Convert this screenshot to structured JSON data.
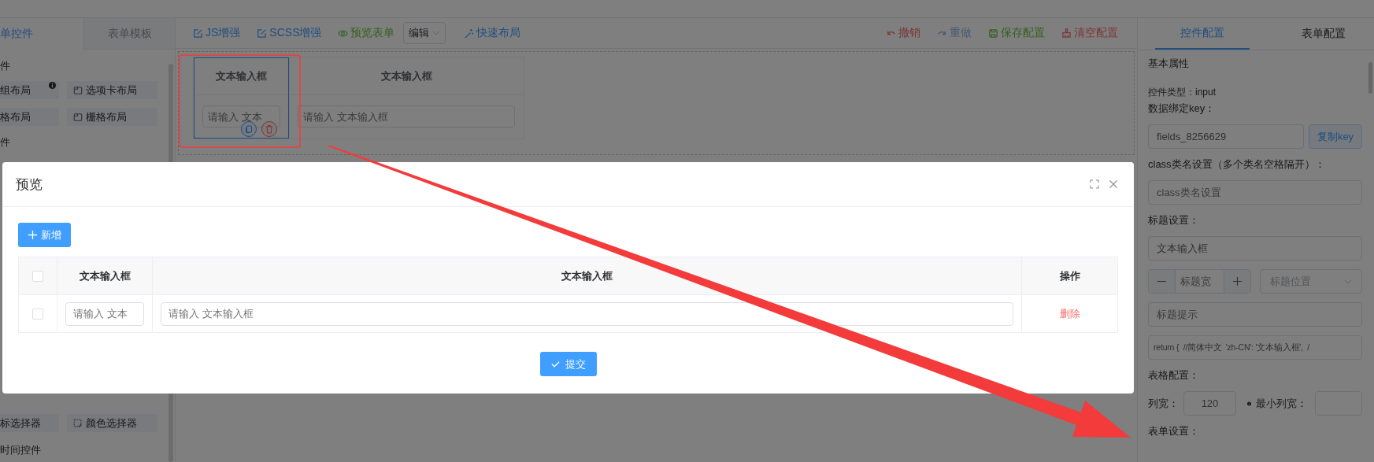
{
  "sidebar": {
    "tabs": [
      {
        "label": "单控件",
        "selected": true
      },
      {
        "label": "表单模板",
        "selected": false
      }
    ],
    "upper": [
      {
        "kind": "heading",
        "text": "件"
      },
      {
        "kind": "items",
        "items": [
          {
            "label": "组布局",
            "info": true
          },
          {
            "label": "选项卡布局",
            "info": false
          },
          {
            "label": "格布局",
            "info": false
          },
          {
            "label": "栅格布局",
            "info": false
          }
        ]
      },
      {
        "kind": "heading",
        "text": "件"
      }
    ],
    "lower": [
      {
        "kind": "items",
        "items": [
          {
            "label": "标选择器",
            "info": false
          },
          {
            "label": "颜色选择器",
            "info": false
          }
        ]
      },
      {
        "kind": "heading",
        "text": "时间控件"
      }
    ]
  },
  "toolbar": {
    "left": [
      {
        "kind": "link",
        "label": "JS增强"
      },
      {
        "kind": "link",
        "label": "SCSS增强"
      },
      {
        "kind": "link",
        "label": "预览表单"
      },
      {
        "kind": "select",
        "value": "编辑"
      },
      {
        "kind": "link",
        "label": "快速布局"
      }
    ],
    "right": [
      {
        "kind": "link",
        "label": "撤销"
      },
      {
        "kind": "link",
        "label": "重做"
      },
      {
        "kind": "link",
        "label": "保存配置"
      },
      {
        "kind": "link",
        "label": "清空配置"
      }
    ]
  },
  "canvas": {
    "columns": [
      {
        "label": "文本输入框",
        "placeholder": "请输入 文本",
        "selected": true
      },
      {
        "label": "文本输入框",
        "placeholder": "请输入 文本输入框",
        "selected": false
      }
    ]
  },
  "config_panel": {
    "tabs": [
      {
        "label": "控件配置",
        "selected": true
      },
      {
        "label": "表单配置",
        "selected": false
      }
    ],
    "section": "基本属性",
    "type_line": "控件类型：input",
    "key_label": "数据绑定key：",
    "key_value": "fields_8256629",
    "copy_button": "复制key",
    "class_label": "class类名设置（多个类名空格隔开）：",
    "class_placeholder": "class类名设置",
    "title_label": "标题设置：",
    "title_value": "文本输入框",
    "title_width_placeholder": "标题宽",
    "title_position_placeholder": "标题位置",
    "title_tip_placeholder": "标题提示",
    "i18n_value": "return {  //简体中文  'zh-CN': '文本输入框',  /",
    "table_label": "表格配置：",
    "col_width_label": "列宽：",
    "col_width_value": "120",
    "min_width_label": "最小列宽：",
    "form_label": "表单设置："
  },
  "dialog": {
    "title": "预览",
    "add_button": "新增",
    "table": {
      "header_checked": false,
      "columns": [
        "文本输入框",
        "文本输入框",
        "操作"
      ],
      "rows": [
        {
          "checked": false,
          "cells": [
            {
              "kind": "input",
              "placeholder": "请输入 文本"
            },
            {
              "kind": "input",
              "placeholder": "请输入 文本输入框"
            },
            {
              "kind": "link",
              "text": "删除"
            }
          ]
        }
      ]
    },
    "submit_button": "提交"
  }
}
